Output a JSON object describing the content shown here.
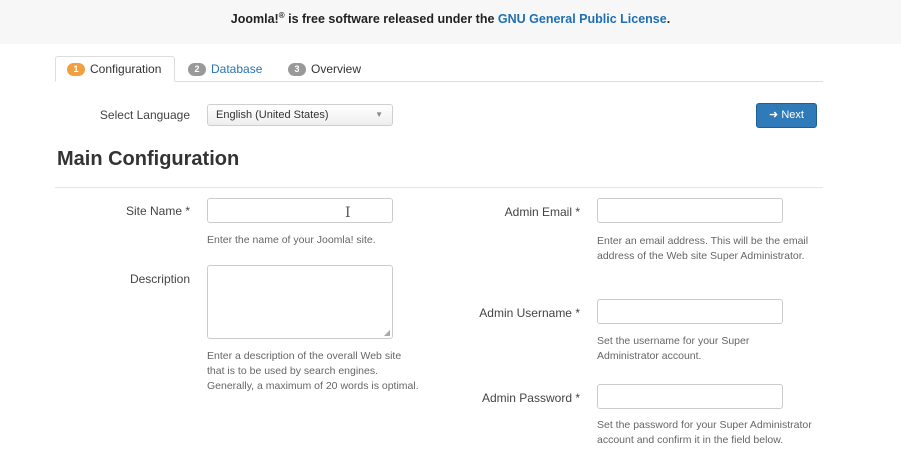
{
  "notice": {
    "joomla": "Joomla!",
    "reg": "®",
    "text": " is free software released under the ",
    "license_link": "GNU General Public License",
    "period": "."
  },
  "tabs": [
    {
      "number": "1",
      "label": "Configuration",
      "active": true
    },
    {
      "number": "2",
      "label": "Database",
      "active": false
    },
    {
      "number": "3",
      "label": "Overview",
      "active": false
    }
  ],
  "language": {
    "label": "Select Language",
    "value": "English (United States)"
  },
  "next_button": {
    "icon": "arrow-right-icon",
    "label": "Next"
  },
  "heading": "Main Configuration",
  "form": {
    "site_name": {
      "label": "Site Name *",
      "value": "",
      "help": "Enter the name of your Joomla! site."
    },
    "description": {
      "label": "Description",
      "value": "",
      "help": "Enter a description of the overall Web site that is to be used by search engines. Generally, a maximum of 20 words is optimal."
    },
    "admin_email": {
      "label": "Admin Email *",
      "value": "",
      "help": "Enter an email address. This will be the email address of the Web site Super Administrator."
    },
    "admin_username": {
      "label": "Admin Username *",
      "value": "",
      "help": "Set the username for your Super Administrator account."
    },
    "admin_password": {
      "label": "Admin Password *",
      "value": "",
      "help": "Set the password for your Super Administrator account and confirm it in the field below."
    }
  },
  "colors": {
    "accent": "#2f7ab8",
    "step_active": "#f0a040",
    "step_inactive": "#999999",
    "link": "#1f6fb3"
  }
}
